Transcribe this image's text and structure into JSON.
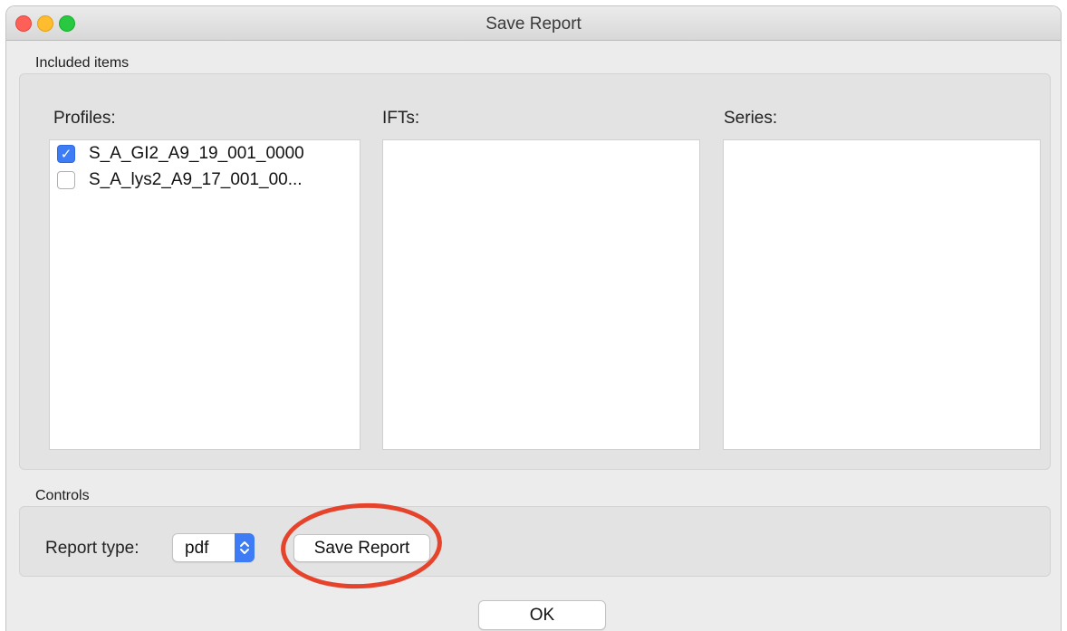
{
  "window": {
    "title": "Save Report"
  },
  "included": {
    "label": "Included items",
    "profiles": {
      "label": "Profiles:",
      "items": [
        {
          "name": "S_A_GI2_A9_19_001_0000",
          "checked": true
        },
        {
          "name": "S_A_lys2_A9_17_001_00...",
          "checked": false
        }
      ]
    },
    "ifts": {
      "label": "IFTs:",
      "items": []
    },
    "series": {
      "label": "Series:",
      "items": []
    }
  },
  "controls": {
    "label": "Controls",
    "report_type_label": "Report type:",
    "report_type_value": "pdf",
    "save_button": "Save Report"
  },
  "ok_button": "OK",
  "annotation_color": "#e5432b",
  "accent_color": "#3d7cf5"
}
